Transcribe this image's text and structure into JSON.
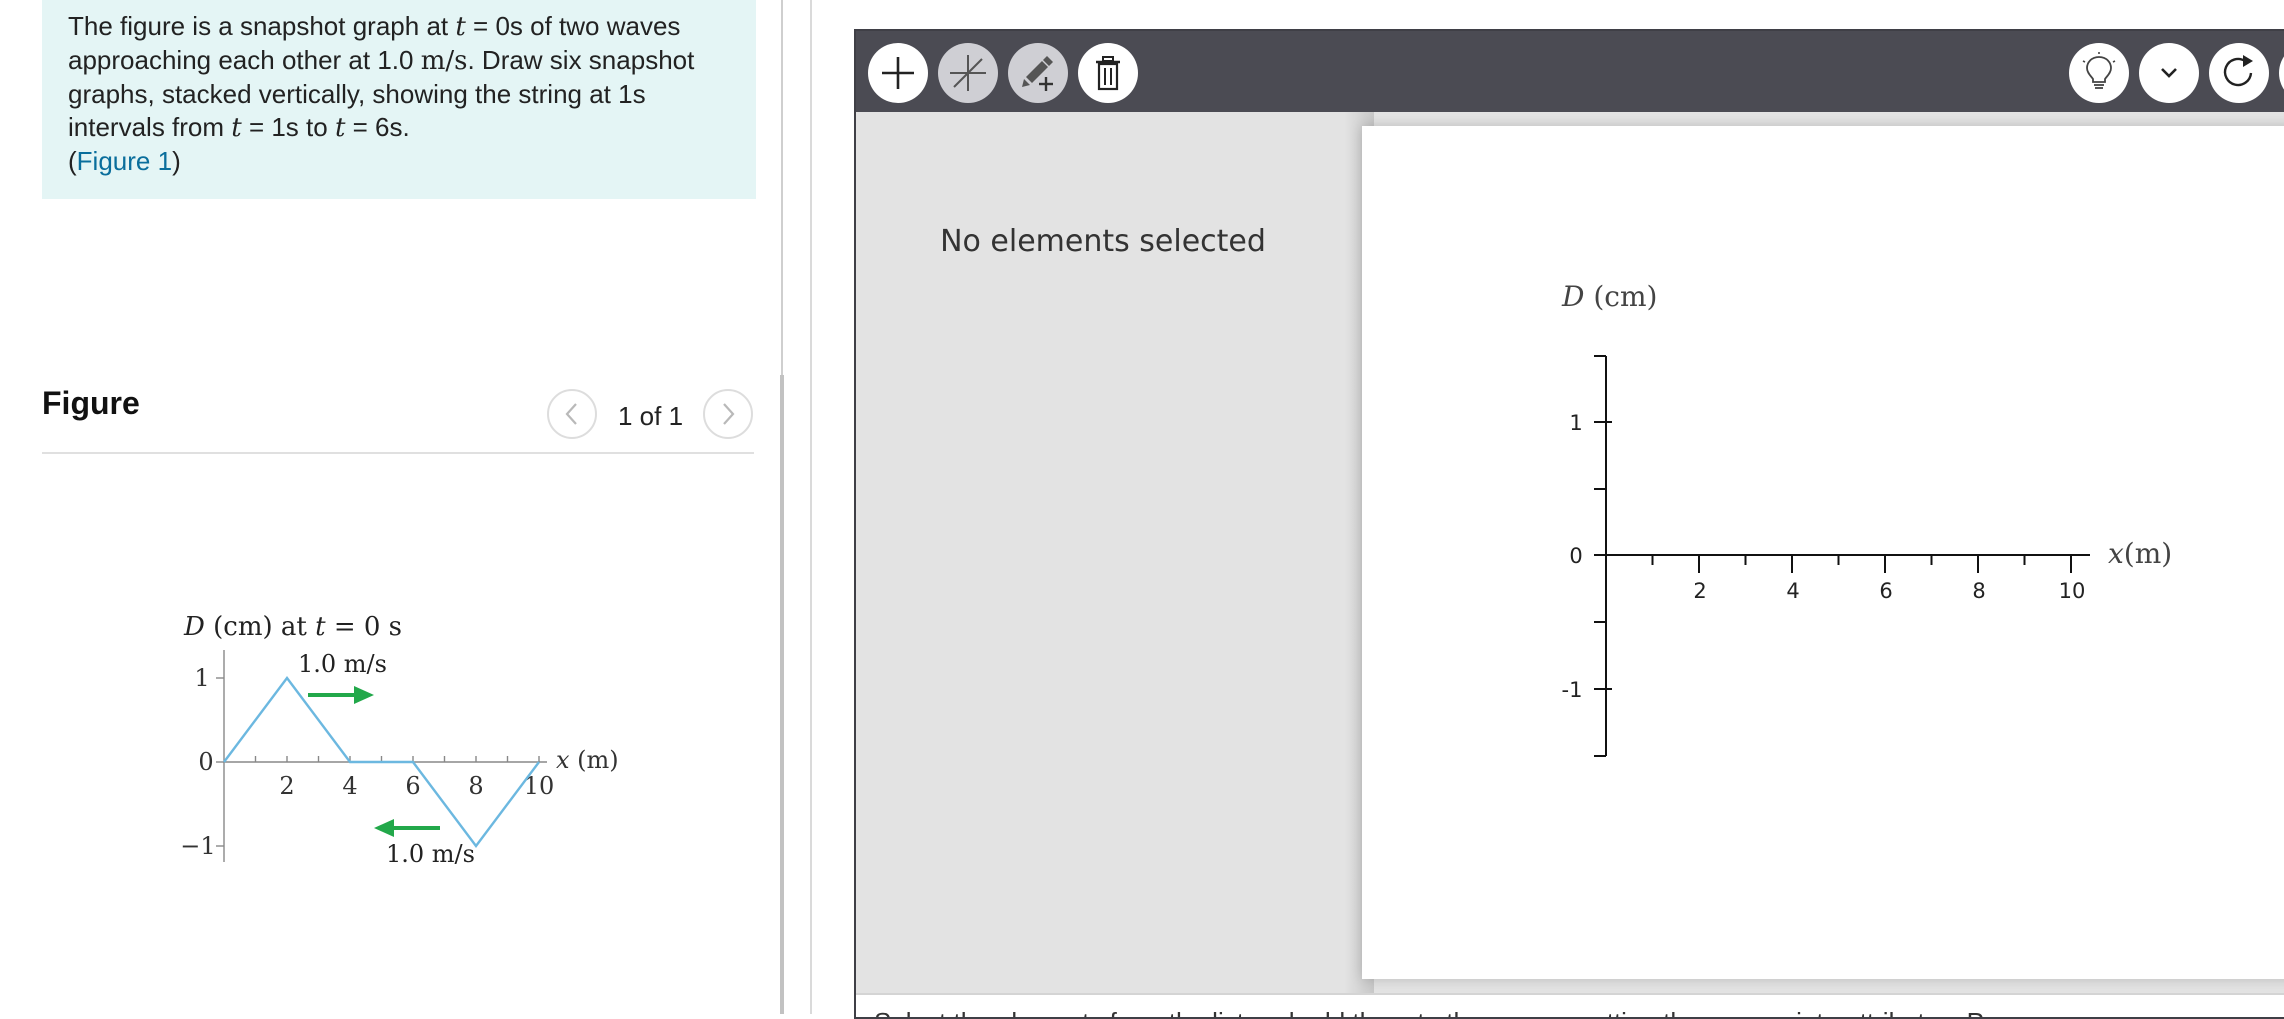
{
  "problem": {
    "seg1": "The figure is a snapshot graph at ",
    "var_t": "t",
    "seg2": " = 0s of two waves approaching each other at 1.0 ",
    "unit": "m/s",
    "seg3": ". Draw six snapshot graphs, stacked vertically, showing the string at 1s intervals from ",
    "seg4": " = 1s to ",
    "seg5": " = 6s.",
    "link_open": "(",
    "link_text": "Figure 1",
    "link_close": ")"
  },
  "figure": {
    "heading": "Figure",
    "pager": "1 of 1",
    "graph": {
      "title_var": "D",
      "title_rest": " (cm) at ",
      "title_t": "t",
      "title_end": " = 0 s",
      "x_label_var": "x",
      "x_label_unit": " (m)",
      "y_ticks": [
        "1",
        "0",
        "−1"
      ],
      "x_ticks": [
        "2",
        "4",
        "6",
        "8",
        "10"
      ],
      "speed_top": "1.0 m/s",
      "speed_bottom": "1.0 m/s",
      "wave_color": "#6cb8e0",
      "arrow_color": "#22a84a",
      "wave_points": [
        [
          0,
          0
        ],
        [
          2,
          1
        ],
        [
          4,
          0
        ],
        [
          6,
          0
        ],
        [
          8,
          -1
        ],
        [
          10,
          0
        ]
      ]
    }
  },
  "tool": {
    "toolbar_icons": [
      "plus-icon",
      "line-tool-icon",
      "pen-plus-icon",
      "trash-icon",
      "lightbulb-icon",
      "chevron-down-icon",
      "redo-icon"
    ],
    "no_selection": "No elements selected",
    "graph": {
      "y_label_var": "D",
      "y_label_unit": " (cm)",
      "x_label_var": "x",
      "x_label_unit": "(m)",
      "y_ticks": [
        "1",
        "0",
        "-1"
      ],
      "x_ticks": [
        "2",
        "4",
        "6",
        "8",
        "10"
      ]
    },
    "instruction": "Select the elements from the list and add them to the canvas setting the appropriate attributes. Press"
  }
}
